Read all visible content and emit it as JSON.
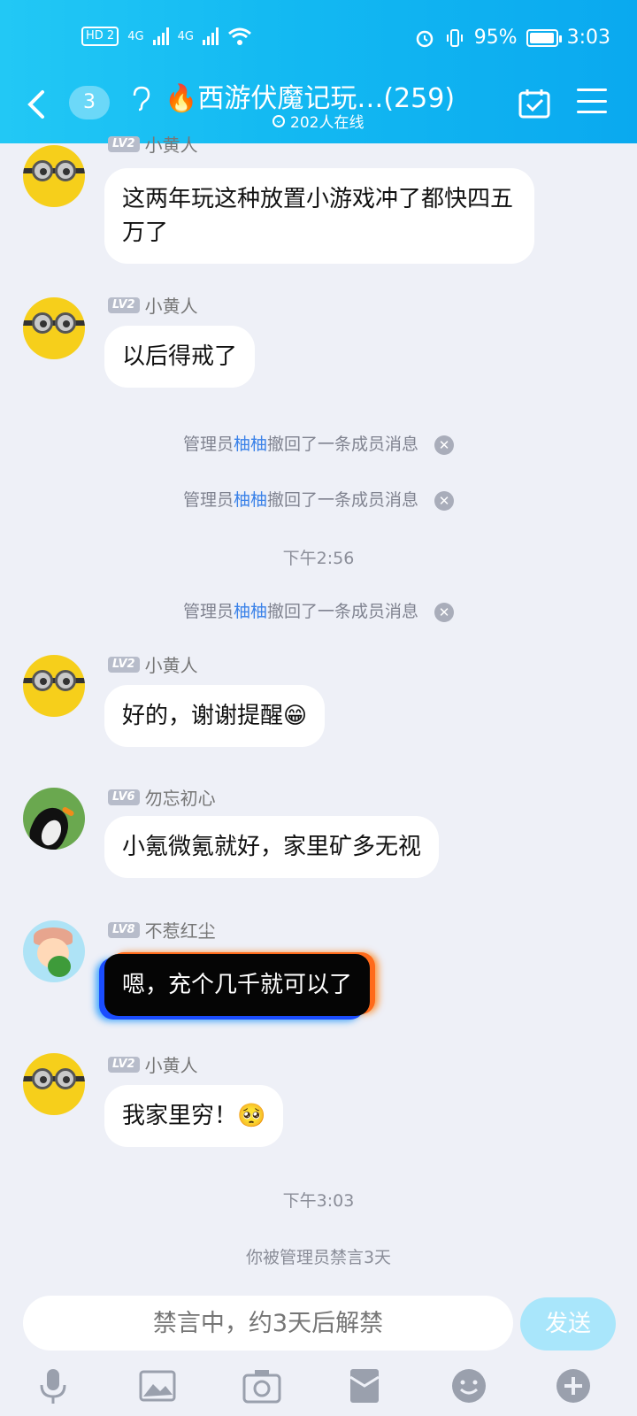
{
  "status_bar": {
    "network": "4G",
    "battery": "95%",
    "battery_fill": 0.95,
    "time": "3:03"
  },
  "header": {
    "unread_count": "3",
    "title": "🔥西游伏魔记玩…(259)",
    "online": "202人在线"
  },
  "messages": [
    {
      "level": "LV2",
      "name": "小黄人",
      "avatar": "minion-avatar",
      "text": "这两年玩这种放置小游戏冲了都快四五万了"
    },
    {
      "level": "LV2",
      "name": "小黄人",
      "avatar": "minion-avatar",
      "text": "以后得戒了"
    },
    {
      "level": "LV2",
      "name": "小黄人",
      "avatar": "minion-avatar",
      "text": "好的，谢谢提醒😁"
    },
    {
      "level": "LV6",
      "name": "勿忘初心",
      "avatar": "penguin-avatar",
      "text": "小氪微氪就好，家里矿多无视"
    },
    {
      "level": "LV8",
      "name": "不惹红尘",
      "avatar": "girl-avatar",
      "text": "嗯，充个几千就可以了"
    },
    {
      "level": "LV2",
      "name": "小黄人",
      "avatar": "minion-avatar",
      "text": "我家里穷！🥺"
    }
  ],
  "system_notices": [
    {
      "prefix": "管理员",
      "admin": "柚柚",
      "suffix": "撤回了一条成员消息"
    },
    {
      "prefix": "管理员",
      "admin": "柚柚",
      "suffix": "撤回了一条成员消息"
    },
    {
      "prefix": "管理员",
      "admin": "柚柚",
      "suffix": "撤回了一条成员消息"
    }
  ],
  "times": [
    "下午2:56",
    "下午3:03"
  ],
  "muted_notice": "你被管理员禁言3天",
  "input": {
    "placeholder": "禁言中，约3天后解禁"
  },
  "send_label": "发送",
  "toolbar": [
    "microphone-icon",
    "image-icon",
    "camera-icon",
    "red-packet-icon",
    "emoji-icon",
    "plus-icon"
  ]
}
